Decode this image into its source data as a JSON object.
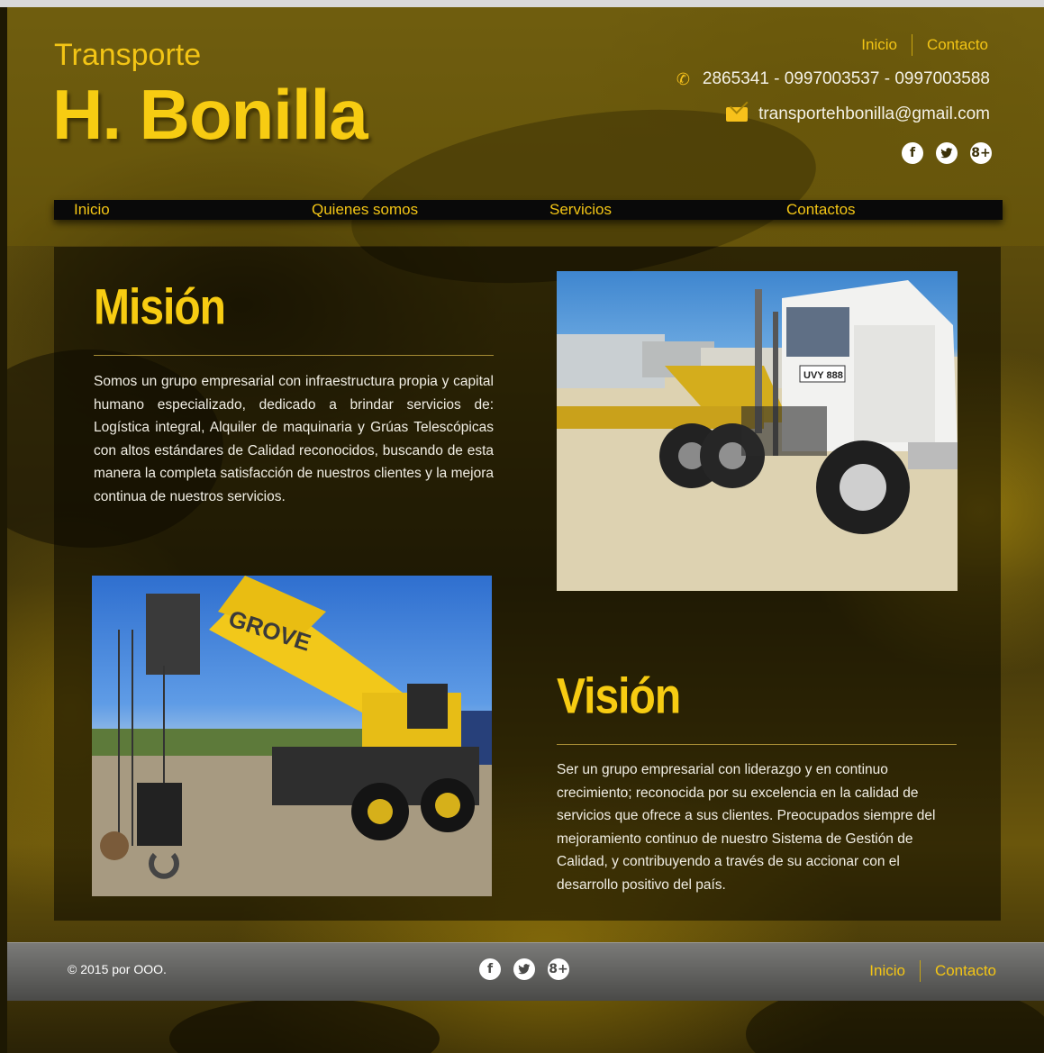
{
  "header": {
    "brand_small": "Transporte",
    "brand_big": "H. Bonilla",
    "links": {
      "home": "Inicio",
      "contact": "Contacto"
    },
    "phone": "2865341 - 0997003537 - 0997003588",
    "email": "transportehbonilla@gmail.com"
  },
  "nav": {
    "items": [
      "Inicio",
      "Quienes somos",
      "Servicios",
      "Contactos"
    ]
  },
  "mision": {
    "title": "Misión",
    "text": "Somos un grupo empresarial con infraestructura propia y capital humano especializado, dedicado a brindar servicios de: Logística integral, Alquiler de maquinaria y Grúas Telescópicas con altos estándares de Calidad reconocidos, buscando de esta manera la completa satisfacción de nuestros clientes y la mejora continua de nuestros servicios."
  },
  "vision": {
    "title": "Visión",
    "text": "Ser un grupo empresarial con liderazgo y en continuo crecimiento; reconocida por su excelencia en la calidad de servicios que ofrece a sus clientes. Preocupados siempre del mejoramiento continuo de nuestro Sistema de Gestión de Calidad, y contribuyendo a través de su accionar con el desarrollo positivo del país."
  },
  "images": {
    "truck_plate": "UVY 888",
    "crane_brand": "GROVE"
  },
  "social": {
    "facebook": "f",
    "twitter": "t",
    "googleplus": "8+"
  },
  "footer": {
    "copyright": "© 2015 por OOO.",
    "links": {
      "home": "Inicio",
      "contact": "Contacto"
    }
  },
  "colors": {
    "accent": "#f7cc12",
    "text": "#f1eee4",
    "nav_bg": "#090909"
  }
}
